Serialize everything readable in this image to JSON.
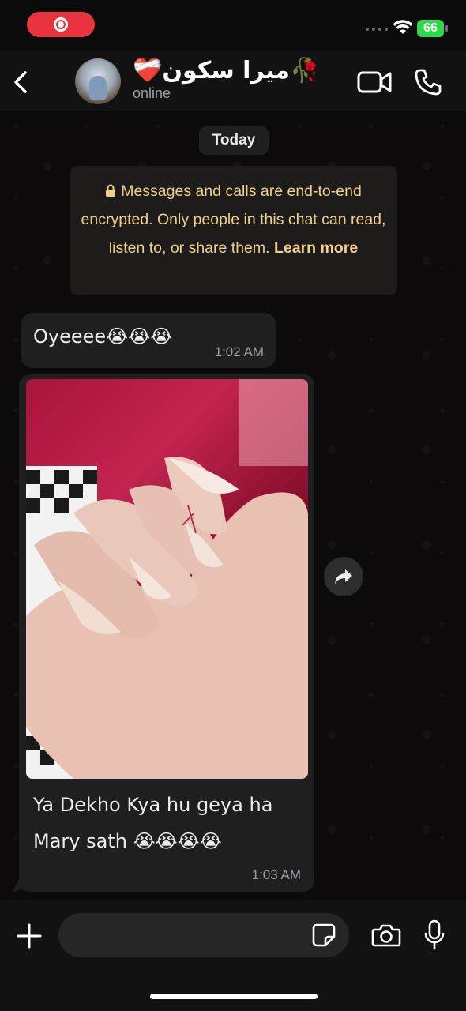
{
  "status_bar": {
    "battery": "66",
    "recording_icon": "screen-record-icon",
    "wifi_icon": "wifi-icon",
    "colors": {
      "recording_pill": "#e7343f",
      "battery": "#32d74b"
    }
  },
  "header": {
    "contact_name": "❤️‍🩹میرا سکون🥀",
    "contact_status": "online",
    "icons": [
      "back-chevron-icon",
      "video-call-icon",
      "phone-call-icon"
    ]
  },
  "chat": {
    "date_label": "Today",
    "encryption_notice": "Messages and calls are end-to-end encrypted. Only people in this chat can read, listen to, or share them.",
    "encryption_learn_more": "Learn more",
    "messages": [
      {
        "type": "text",
        "text": "Oyeeee😭😭😭",
        "time": "1:02 AM"
      },
      {
        "type": "image",
        "caption_line1": "Ya Dekho Kya hu geya ha",
        "caption_line2": "Mary sath 😭😭😭😭",
        "time": "1:03 AM"
      }
    ],
    "colors": {
      "notice_text": "#f0d089",
      "bubble": "#1f1f1f"
    }
  },
  "input_bar": {
    "placeholder": "",
    "icons": [
      "plus-icon",
      "sticker-icon",
      "camera-icon",
      "microphone-icon"
    ]
  }
}
